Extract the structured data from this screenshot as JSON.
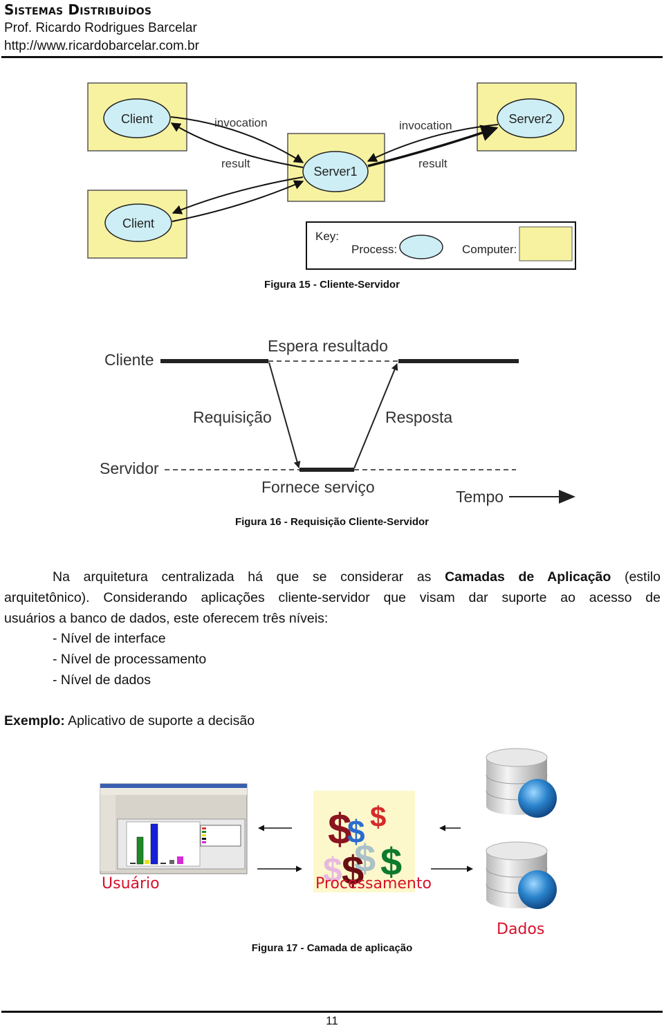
{
  "header": {
    "title": "Sistemas Distribuídos",
    "author": "Prof. Ricardo Rodrigues Barcelar",
    "url": "http://www.ricardobarcelar.com.br"
  },
  "figure15": {
    "caption": "Figura 15 - Cliente-Servidor",
    "nodes": {
      "client1": "Client",
      "client2": "Client",
      "server1": "Server1",
      "server2": "Server2"
    },
    "edge_labels": {
      "invocation_left": "invocation",
      "result_left": "result",
      "invocation_right": "invocation",
      "result_right": "result"
    },
    "key": {
      "title": "Key:",
      "process": "Process:",
      "computer": "Computer:"
    },
    "colors": {
      "computer": "#f7f2a0",
      "process": "#cdeef4"
    }
  },
  "figure16": {
    "caption": "Figura 16 - Requisição Cliente-Servidor",
    "client": "Cliente",
    "server": "Servidor",
    "wait": "Espera resultado",
    "request": "Requisição",
    "response": "Resposta",
    "serve": "Fornece serviço",
    "time": "Tempo"
  },
  "body": {
    "para_line1_pre": "Na arquitetura centralizada há que se considerar as",
    "para_line1_bold": "Camadas de Aplicação",
    "para_line1_post": "(estilo",
    "para_line2": "arquitetônico). Considerando aplicações cliente-servidor que visam dar suporte ao acesso de",
    "para_line3": "usuários a banco de dados, este oferecem três níveis:",
    "list": [
      "- Nível de interface",
      "- Nível de processamento",
      "- Nível de dados"
    ],
    "example_bold": "Exemplo:",
    "example_text": "Aplicativo de suporte a decisão"
  },
  "figure17": {
    "caption": "Figura 17 - Camada de aplicação",
    "user_label": "Usuário",
    "processing_label": "Processamento",
    "data_label": "Dados"
  },
  "footer": {
    "page_number": "11"
  }
}
